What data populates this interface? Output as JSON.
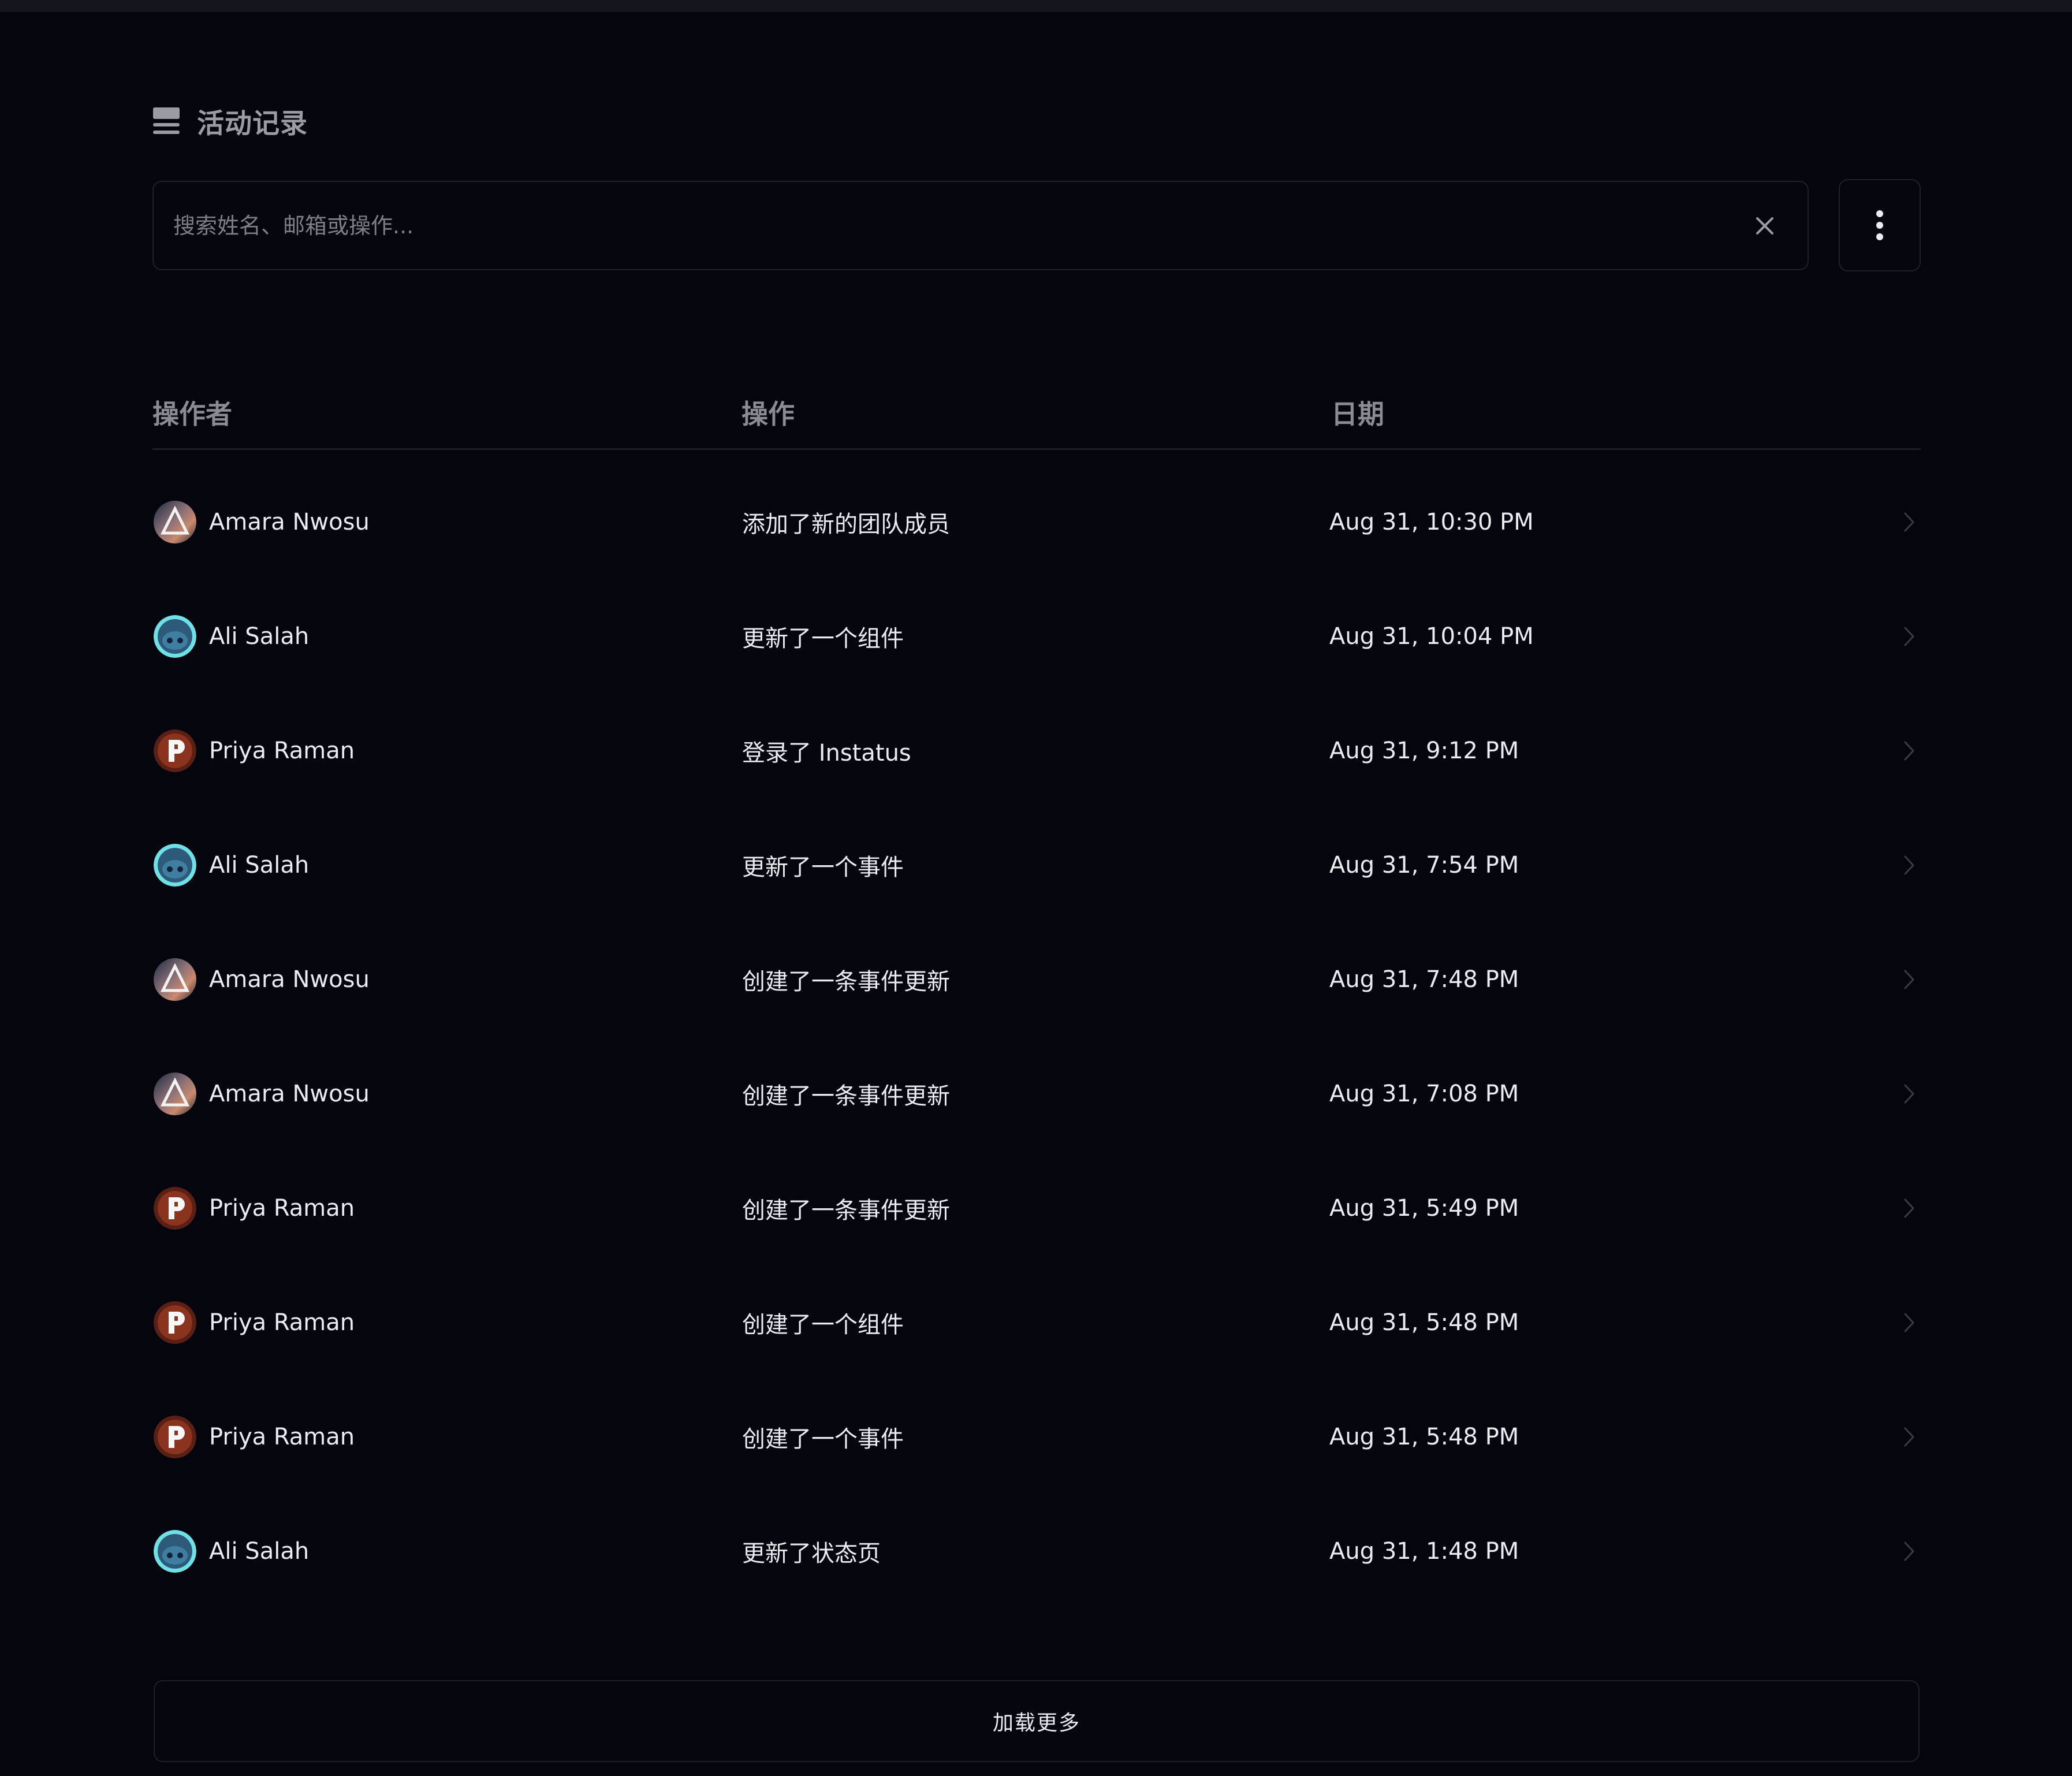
{
  "header": {
    "title": "活动记录",
    "icon": "activity-list-icon"
  },
  "search": {
    "placeholder": "搜索姓名、邮箱或操作...",
    "value": "",
    "clear_icon": "close-icon",
    "more_icon": "more-vertical-icon"
  },
  "table": {
    "columns": [
      "操作者",
      "操作",
      "日期"
    ],
    "rows": [
      {
        "actor": "Amara Nwosu",
        "avatar": "amara",
        "action": "添加了新的团队成员",
        "date": "Aug 31, 10:30 PM"
      },
      {
        "actor": "Ali Salah",
        "avatar": "ali",
        "action": "更新了一个组件",
        "date": "Aug 31, 10:04 PM"
      },
      {
        "actor": "Priya Raman",
        "avatar": "priya",
        "action": "登录了 Instatus",
        "date": "Aug 31, 9:12 PM"
      },
      {
        "actor": "Ali Salah",
        "avatar": "ali",
        "action": "更新了一个事件",
        "date": "Aug 31, 7:54 PM"
      },
      {
        "actor": "Amara Nwosu",
        "avatar": "amara",
        "action": "创建了一条事件更新",
        "date": "Aug 31, 7:48 PM"
      },
      {
        "actor": "Amara Nwosu",
        "avatar": "amara",
        "action": "创建了一条事件更新",
        "date": "Aug 31, 7:08 PM"
      },
      {
        "actor": "Priya Raman",
        "avatar": "priya",
        "action": "创建了一条事件更新",
        "date": "Aug 31, 5:49 PM"
      },
      {
        "actor": "Priya Raman",
        "avatar": "priya",
        "action": "创建了一个组件",
        "date": "Aug 31, 5:48 PM"
      },
      {
        "actor": "Priya Raman",
        "avatar": "priya",
        "action": "创建了一个事件",
        "date": "Aug 31, 5:48 PM"
      },
      {
        "actor": "Ali Salah",
        "avatar": "ali",
        "action": "更新了状态页",
        "date": "Aug 31, 1:48 PM"
      }
    ]
  },
  "load_more": {
    "label": "加载更多"
  },
  "colors": {
    "background": "#04050d",
    "border": "#1f2029",
    "text": "#ececf0",
    "muted": "#8a8b94"
  }
}
